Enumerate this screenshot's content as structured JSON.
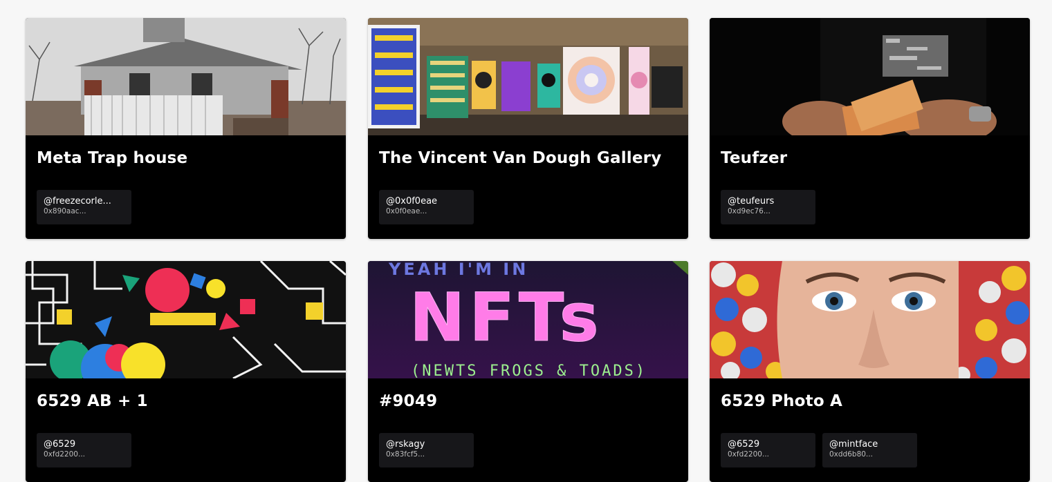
{
  "cards": [
    {
      "title": "Meta Trap house",
      "image": "abandoned-house-photo",
      "owners": [
        {
          "handle": "@freezecorle...",
          "address": "0x890aac..."
        }
      ]
    },
    {
      "title": "The Vincent Van Dough Gallery",
      "image": "virtual-gallery-render",
      "owners": [
        {
          "handle": "@0x0f0eae",
          "address": "0x0f0eae..."
        }
      ]
    },
    {
      "title": "Teufzer",
      "image": "person-counting-money-photo",
      "owners": [
        {
          "handle": "@teufeurs",
          "address": "0xd9ec76..."
        }
      ]
    },
    {
      "title": "6529 AB + 1",
      "image": "abstract-geometric-art",
      "owners": [
        {
          "handle": "@6529",
          "address": "0xfd2200..."
        }
      ]
    },
    {
      "title": "#9049",
      "image": "neon-nfts-poster",
      "image_text": {
        "top": "YEAH I'M IN",
        "main": "NFTs",
        "sub": "(NEWTS FROGS & TOADS)"
      },
      "owners": [
        {
          "handle": "@rskagy",
          "address": "0x83fcf5..."
        }
      ]
    },
    {
      "title": "6529 Photo A",
      "image": "face-in-candy-photo",
      "owners": [
        {
          "handle": "@6529",
          "address": "0xfd2200..."
        },
        {
          "handle": "@mintface",
          "address": "0xdd6b80..."
        }
      ]
    }
  ]
}
